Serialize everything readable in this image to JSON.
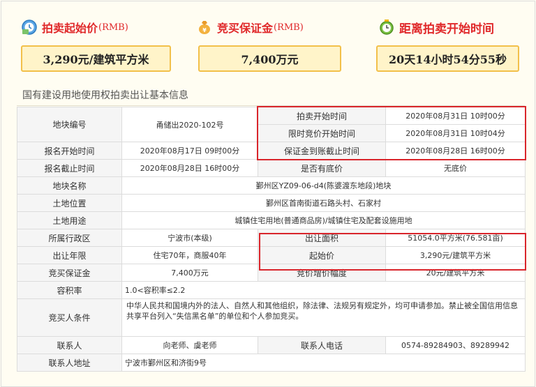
{
  "headers": [
    {
      "icon": "clock-money-icon",
      "label": "拍卖起始价",
      "unit": "(RMB)"
    },
    {
      "icon": "money-bag-icon",
      "label": "竞买保证金",
      "unit": "(RMB)"
    },
    {
      "icon": "alarm-clock-icon",
      "label": "距离拍卖开始时间",
      "unit": ""
    }
  ],
  "values": {
    "start_price": "3,290元/建筑平方米",
    "deposit": "7,400万元",
    "countdown": "20天14小时54分55秒"
  },
  "section_title": "国有建设用地使用权拍卖出让基本信息",
  "table": {
    "plot_no_label": "地块编号",
    "plot_no": "甬储出2020-102号",
    "auction_start_label": "拍卖开始时间",
    "auction_start": "2020年08月31日 10时00分",
    "bid_start_label": "限时竞价开始时间",
    "bid_start": "2020年08月31日 10时04分",
    "signup_start_label": "报名开始时间",
    "signup_start": "2020年08月17日 09时00分",
    "deposit_deadline_label": "保证金到账截止时间",
    "deposit_deadline": "2020年08月28日 16时00分",
    "signup_end_label": "报名截止时间",
    "signup_end": "2020年08月28日 16时00分",
    "reserve_label": "是否有底价",
    "reserve": "无底价",
    "name_label": "地块名称",
    "name": "鄞州区YZ09-06-d4(陈婆渡东地段)地块",
    "location_label": "土地位置",
    "location": "鄞州区首南街道石路头村、石家村",
    "use_label": "土地用途",
    "use": "城镇住宅用地(普通商品房)/城镇住宅及配套设施用地",
    "district_label": "所属行政区",
    "district": "宁波市(本级)",
    "area_label": "出让面积",
    "area": "51054.0平方米(76.581亩)",
    "term_label": "出让年限",
    "term": "住宅70年，商服40年",
    "start_price_label": "起始价",
    "start_price": "3,290元/建筑平方米",
    "deposit_label": "竞买保证金",
    "deposit": "7,400万元",
    "increment_label": "竞价增价幅度",
    "increment": "20元/建筑平方米",
    "far_label": "容积率",
    "far": "1.0<容积率≤2.2",
    "bidder_cond_label": "竞买人条件",
    "bidder_cond": "中华人民共和国境内外的法人、自然人和其他组织，除法律、法规另有规定外，均可申请参加。禁止被全国信用信息共享平台列入“失信黑名单”的单位和个人参加竞买。",
    "contact_label": "联系人",
    "contact": "向老师、虞老师",
    "phone_label": "联系人电话",
    "phone": "0574-89284903、89289942",
    "address_label": "联系人地址",
    "address": "宁波市鄞州区和济街9号"
  }
}
